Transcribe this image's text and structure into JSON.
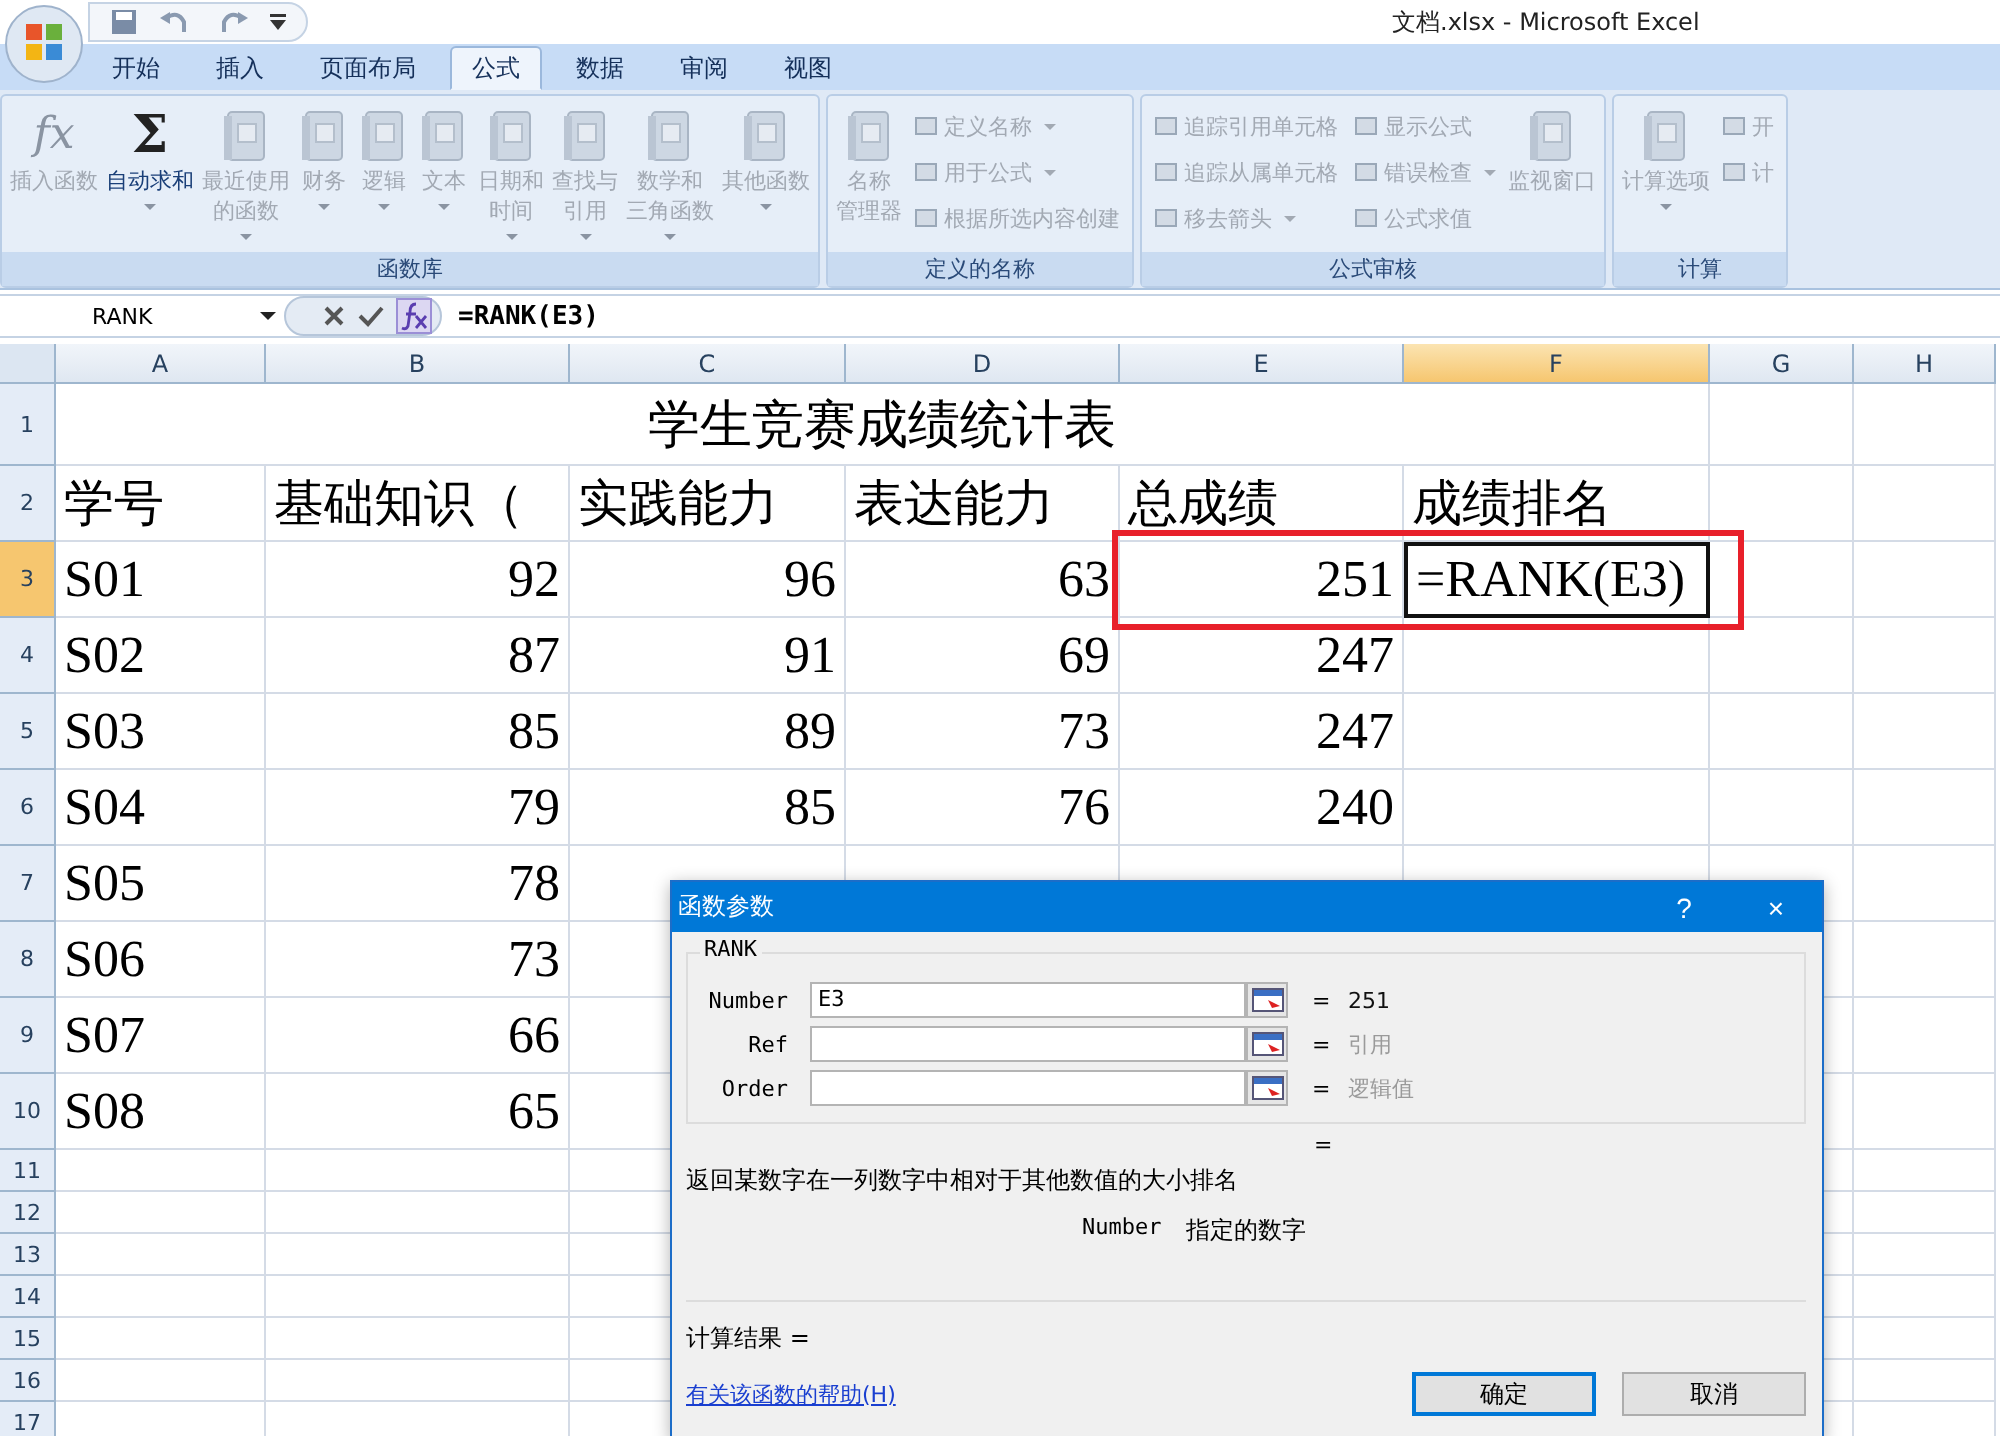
{
  "window": {
    "title": "文档.xlsx - Microsoft Excel"
  },
  "tabs": [
    {
      "label": "开始",
      "selected": false
    },
    {
      "label": "插入",
      "selected": false
    },
    {
      "label": "页面布局",
      "selected": false
    },
    {
      "label": "公式",
      "selected": true
    },
    {
      "label": "数据",
      "selected": false
    },
    {
      "label": "审阅",
      "selected": false
    },
    {
      "label": "视图",
      "selected": false
    }
  ],
  "ribbon": {
    "groups": [
      {
        "label": "函数库",
        "items": [
          {
            "kind": "large",
            "glyph": "fx",
            "lines": [
              "插入函数"
            ],
            "dropdown": false,
            "disabled": true
          },
          {
            "kind": "large",
            "glyph": "Σ",
            "lines": [
              "自动求和"
            ],
            "dropdown": true,
            "disabled": false
          },
          {
            "kind": "large",
            "lines": [
              "最近使用",
              "的函数"
            ],
            "dropdown": true,
            "disabled": true
          },
          {
            "kind": "large",
            "lines": [
              "财务"
            ],
            "dropdown": true,
            "disabled": true
          },
          {
            "kind": "large",
            "lines": [
              "逻辑"
            ],
            "dropdown": true,
            "disabled": true
          },
          {
            "kind": "large",
            "lines": [
              "文本"
            ],
            "dropdown": true,
            "disabled": true
          },
          {
            "kind": "large",
            "lines": [
              "日期和",
              "时间"
            ],
            "dropdown": true,
            "disabled": true
          },
          {
            "kind": "large",
            "lines": [
              "查找与",
              "引用"
            ],
            "dropdown": true,
            "disabled": true
          },
          {
            "kind": "large",
            "lines": [
              "数学和",
              "三角函数"
            ],
            "dropdown": true,
            "disabled": true
          },
          {
            "kind": "large",
            "lines": [
              "其他函数"
            ],
            "dropdown": true,
            "disabled": true
          }
        ]
      },
      {
        "label": "定义的名称",
        "items": [
          {
            "kind": "large",
            "lines": [
              "名称",
              "管理器"
            ],
            "dropdown": false,
            "disabled": true
          },
          {
            "kind": "stack",
            "buttons": [
              {
                "label": "定义名称",
                "dropdown": true
              },
              {
                "label": "用于公式",
                "dropdown": true
              },
              {
                "label": "根据所选内容创建",
                "dropdown": false
              }
            ]
          }
        ]
      },
      {
        "label": "公式审核",
        "items": [
          {
            "kind": "stack",
            "buttons": [
              {
                "label": "追踪引用单元格",
                "dropdown": false
              },
              {
                "label": "追踪从属单元格",
                "dropdown": false
              },
              {
                "label": "移去箭头",
                "dropdown": true
              }
            ]
          },
          {
            "kind": "stack",
            "buttons": [
              {
                "label": "显示公式",
                "dropdown": false
              },
              {
                "label": "错误检查",
                "dropdown": true
              },
              {
                "label": "公式求值",
                "dropdown": false
              }
            ]
          },
          {
            "kind": "large",
            "lines": [
              "监视窗口"
            ],
            "dropdown": false,
            "disabled": true
          }
        ]
      },
      {
        "label": "计算",
        "items": [
          {
            "kind": "large",
            "lines": [
              "计算选项"
            ],
            "dropdown": true,
            "disabled": true
          },
          {
            "kind": "stack",
            "buttons": [
              {
                "label": "开",
                "dropdown": false
              },
              {
                "label": "计",
                "dropdown": false
              }
            ]
          }
        ]
      }
    ]
  },
  "formula_bar": {
    "name_box": "RANK",
    "formula": "=RANK(E3)"
  },
  "columns": [
    {
      "label": "A",
      "selected": false
    },
    {
      "label": "B",
      "selected": false
    },
    {
      "label": "C",
      "selected": false
    },
    {
      "label": "D",
      "selected": false
    },
    {
      "label": "E",
      "selected": false
    },
    {
      "label": "F",
      "selected": true
    },
    {
      "label": "G",
      "selected": false
    },
    {
      "label": "H",
      "selected": false
    }
  ],
  "rows": [
    {
      "number": "1",
      "kind": "title",
      "selected": false,
      "cells": [
        "学生竞赛成绩统计表"
      ]
    },
    {
      "number": "2",
      "kind": "header",
      "selected": false,
      "cells": [
        "学号",
        "基础知识（",
        "实践能力",
        "表达能力",
        "总成绩",
        "成绩排名"
      ]
    },
    {
      "number": "3",
      "kind": "data",
      "selected": true,
      "cells": [
        "S01",
        "92",
        "96",
        "63",
        "251",
        "=RANK(E3)"
      ]
    },
    {
      "number": "4",
      "kind": "data",
      "selected": false,
      "cells": [
        "S02",
        "87",
        "91",
        "69",
        "247"
      ]
    },
    {
      "number": "5",
      "kind": "data",
      "selected": false,
      "cells": [
        "S03",
        "85",
        "89",
        "73",
        "247"
      ]
    },
    {
      "number": "6",
      "kind": "data",
      "selected": false,
      "cells": [
        "S04",
        "79",
        "85",
        "76",
        "240"
      ]
    },
    {
      "number": "7",
      "kind": "data",
      "selected": false,
      "cells": [
        "S05",
        "78"
      ]
    },
    {
      "number": "8",
      "kind": "data",
      "selected": false,
      "cells": [
        "S06",
        "73"
      ]
    },
    {
      "number": "9",
      "kind": "data",
      "selected": false,
      "cells": [
        "S07",
        "66"
      ]
    },
    {
      "number": "10",
      "kind": "data",
      "selected": false,
      "cells": [
        "S08",
        "65"
      ]
    },
    {
      "number": "11",
      "kind": "empty",
      "selected": false
    },
    {
      "number": "12",
      "kind": "empty",
      "selected": false
    },
    {
      "number": "13",
      "kind": "empty",
      "selected": false
    },
    {
      "number": "14",
      "kind": "empty",
      "selected": false
    },
    {
      "number": "15",
      "kind": "empty",
      "selected": false
    },
    {
      "number": "16",
      "kind": "empty",
      "selected": false
    },
    {
      "number": "17",
      "kind": "empty",
      "selected": false
    }
  ],
  "highlight": {
    "kind": "rectangle"
  },
  "dialog": {
    "title": "函数参数",
    "help": "?",
    "close": "×",
    "function": "RANK",
    "args": [
      {
        "label": "Number",
        "value": "E3",
        "result": "251",
        "hint": false
      },
      {
        "label": "Ref",
        "result": "引用",
        "hint": true
      },
      {
        "label": "Order",
        "result": "逻辑值",
        "hint": true
      }
    ],
    "equals": "=",
    "description": "返回某数字在一列数字中相对于其他数值的大小排名",
    "arg_help": {
      "name": "Number",
      "text": "指定的数字"
    },
    "result_label": "计算结果 =",
    "help_link": "有关该函数的帮助(H)",
    "buttons": [
      {
        "label": "确定",
        "default": true
      },
      {
        "label": "取消",
        "default": false
      }
    ]
  }
}
